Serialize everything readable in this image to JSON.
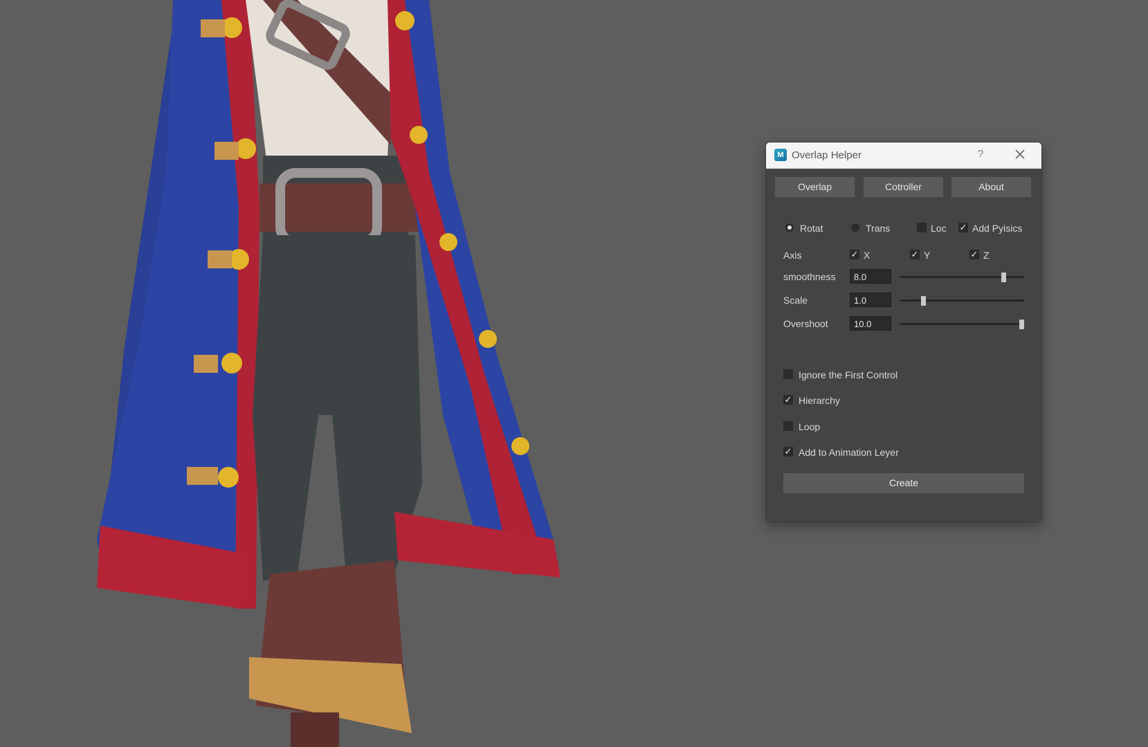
{
  "dialog": {
    "title": "Overlap Helper",
    "help_label": "?",
    "tabs": [
      {
        "label": "Overlap"
      },
      {
        "label": "Cotroller"
      },
      {
        "label": "About"
      }
    ],
    "mode": {
      "rotat": {
        "label": "Rotat",
        "selected": true
      },
      "trans": {
        "label": "Trans",
        "selected": false
      },
      "loc": {
        "label": "Loc",
        "checked": false
      },
      "add_physics": {
        "label": "Add Pyisics",
        "checked": true
      }
    },
    "axis": {
      "label": "Axis",
      "x": {
        "label": "X",
        "checked": true
      },
      "y": {
        "label": "Y",
        "checked": true
      },
      "z": {
        "label": "Z",
        "checked": true
      }
    },
    "sliders": {
      "smoothness": {
        "label": "smoothness",
        "value": "8.0",
        "fraction": 0.85
      },
      "scale": {
        "label": "Scale",
        "value": "1.0",
        "fraction": 0.18
      },
      "overshoot": {
        "label": "Overshoot",
        "value": "10.0",
        "fraction": 1.0
      }
    },
    "options": {
      "ignore_first": {
        "label": "Ignore the First Control",
        "checked": false
      },
      "hierarchy": {
        "label": "Hierarchy",
        "checked": true
      },
      "loop": {
        "label": "Loop",
        "checked": false
      },
      "add_anim_layer": {
        "label": "Add to Animation Leyer",
        "checked": true
      }
    },
    "create_label": "Create",
    "check_glyph": "✓"
  }
}
